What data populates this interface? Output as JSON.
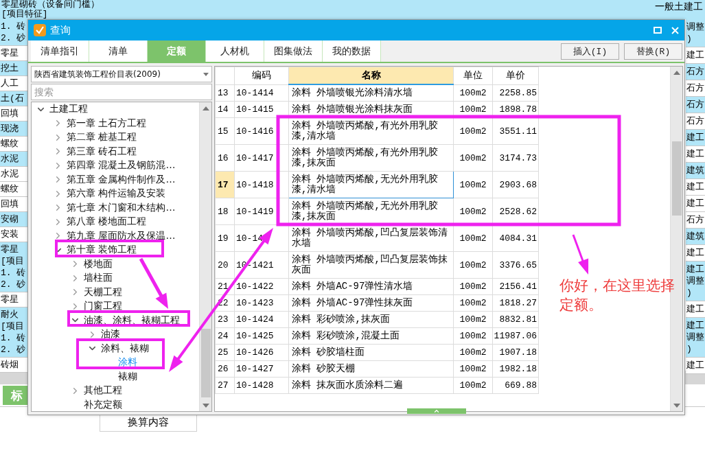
{
  "background": {
    "top_lines": [
      "零星砌砖（设备间门槛）",
      "[项目特征]"
    ],
    "top_right": "一般土建工",
    "left_cells": [
      {
        "lines": [
          "1. 砖",
          "2. 砂"
        ],
        "highlighted": true
      },
      {
        "lines": [
          "零星"
        ],
        "highlighted": false
      },
      {
        "lines": [
          "挖土"
        ],
        "highlighted": true
      },
      {
        "lines": [
          "人工"
        ],
        "highlighted": false
      },
      {
        "lines": [
          "土(石"
        ],
        "highlighted": true
      },
      {
        "lines": [
          "回填"
        ],
        "highlighted": false
      },
      {
        "lines": [
          "现浇"
        ],
        "highlighted": true
      },
      {
        "lines": [
          "螺纹"
        ],
        "highlighted": false
      },
      {
        "lines": [
          "水泥"
        ],
        "highlighted": true
      },
      {
        "lines": [
          "水泥"
        ],
        "highlighted": false
      },
      {
        "lines": [
          "螺纹"
        ],
        "highlighted": false
      },
      {
        "lines": [
          "回填"
        ],
        "highlighted": false
      },
      {
        "lines": [
          "安砌"
        ],
        "highlighted": true
      },
      {
        "lines": [
          "安装"
        ],
        "highlighted": false
      },
      {
        "lines": [
          "零星",
          "[项目",
          "1. 砖",
          "2. 砂"
        ],
        "highlighted": true
      },
      {
        "lines": [
          "零星"
        ],
        "highlighted": false
      },
      {
        "lines": [
          "耐火",
          "[项目",
          "1. 砖",
          "2. 砂"
        ],
        "highlighted": true
      },
      {
        "lines": [
          "砖烟"
        ],
        "highlighted": false
      }
    ],
    "right_cells": [
      {
        "lines": [
          "调整",
          ")"
        ],
        "highlighted": true
      },
      {
        "lines": [
          "建工"
        ],
        "highlighted": false
      },
      {
        "lines": [
          "石方"
        ],
        "highlighted": true
      },
      {
        "lines": [
          "石方"
        ],
        "highlighted": false
      },
      {
        "lines": [
          "石方"
        ],
        "highlighted": true
      },
      {
        "lines": [
          "石方"
        ],
        "highlighted": false
      },
      {
        "lines": [
          "建工"
        ],
        "highlighted": true
      },
      {
        "lines": [
          "建工"
        ],
        "highlighted": false
      },
      {
        "lines": [
          "建筑"
        ],
        "highlighted": true
      },
      {
        "lines": [
          "建工"
        ],
        "highlighted": false
      },
      {
        "lines": [
          "建工"
        ],
        "highlighted": false
      },
      {
        "lines": [
          "石方"
        ],
        "highlighted": false
      },
      {
        "lines": [
          "建筑"
        ],
        "highlighted": true
      },
      {
        "lines": [
          "建工"
        ],
        "highlighted": false
      },
      {
        "lines": [
          "建工",
          "调整",
          ")"
        ],
        "highlighted": true
      },
      {
        "lines": [
          "建工"
        ],
        "highlighted": false
      },
      {
        "lines": [
          "建工",
          "调整",
          ")"
        ],
        "highlighted": true
      },
      {
        "lines": [
          "建工"
        ],
        "highlighted": false
      }
    ],
    "bottom_tab": {
      "label": "标",
      "selected": true
    },
    "bottom_cell": "换算内容"
  },
  "dialog": {
    "title": "查询",
    "tabs": [
      {
        "label": "清单指引",
        "selected": false
      },
      {
        "label": "清单",
        "selected": false
      },
      {
        "label": "定额",
        "selected": true
      },
      {
        "label": "人材机",
        "selected": false
      },
      {
        "label": "图集做法",
        "selected": false
      },
      {
        "label": "我的数据",
        "selected": false
      }
    ],
    "buttons": [
      "插入(I)",
      "替换(R)"
    ],
    "library": "陕西省建筑装饰工程价目表(2009)",
    "search": {
      "placeholder": "搜索"
    },
    "tree": [
      {
        "label": "土建工程",
        "expanded": true,
        "selected": false,
        "children": [
          {
            "label": "第一章  土石方工程",
            "expanded": false,
            "selected": false
          },
          {
            "label": "第二章  桩基工程",
            "expanded": false,
            "selected": false
          },
          {
            "label": "第三章  砖石工程",
            "expanded": false,
            "selected": false
          },
          {
            "label": "第四章  混凝土及钢筋混…",
            "expanded": false,
            "selected": false
          },
          {
            "label": "第五章  金属构件制作及…",
            "expanded": false,
            "selected": false
          },
          {
            "label": "第六章  构件运输及安装",
            "expanded": false,
            "selected": false
          },
          {
            "label": "第七章  木门窗和木结构…",
            "expanded": false,
            "selected": false
          },
          {
            "label": "第八章  楼地面工程",
            "expanded": false,
            "selected": false
          },
          {
            "label": "第九章  屋面防水及保温…",
            "expanded": false,
            "selected": false
          },
          {
            "label": "第十章  装饰工程",
            "expanded": true,
            "selected": false,
            "children": [
              {
                "label": "楼地面",
                "expanded": false,
                "selected": false
              },
              {
                "label": "墙柱面",
                "expanded": false,
                "selected": false
              },
              {
                "label": "天棚工程",
                "expanded": false,
                "selected": false
              },
              {
                "label": "门窗工程",
                "expanded": false,
                "selected": false
              },
              {
                "label": "油漆、涂料、裱糊工程",
                "expanded": true,
                "selected": false,
                "children": [
                  {
                    "label": "油漆",
                    "expanded": false,
                    "selected": false
                  },
                  {
                    "label": "涂料、裱糊",
                    "expanded": true,
                    "selected": false,
                    "children": [
                      {
                        "label": "涂料",
                        "selected": true
                      },
                      {
                        "label": "裱糊",
                        "selected": false
                      }
                    ]
                  }
                ]
              },
              {
                "label": "其他工程",
                "expanded": false,
                "selected": false
              },
              {
                "label": "补充定额",
                "selected": false
              }
            ]
          }
        ]
      }
    ],
    "table": {
      "columns": [
        {
          "label": "编码",
          "selected": false
        },
        {
          "label": "名称",
          "selected": true
        },
        {
          "label": "单位",
          "selected": false
        },
        {
          "label": "单价",
          "selected": false
        }
      ],
      "rows": [
        {
          "num": "13",
          "code": "10-1414",
          "name": "涂料  外墙喷银光涂料清水墙",
          "unit": "100m2",
          "price": "2258.85",
          "selected": false
        },
        {
          "num": "14",
          "code": "10-1415",
          "name": "涂料  外墙喷银光涂料抹灰面",
          "unit": "100m2",
          "price": "1898.78",
          "selected": false
        },
        {
          "num": "15",
          "code": "10-1416",
          "name": "涂料  外墙喷丙烯酸,有光外用乳胶漆,清水墙",
          "unit": "100m2",
          "price": "3551.11",
          "selected": false
        },
        {
          "num": "16",
          "code": "10-1417",
          "name": "涂料  外墙喷丙烯酸,有光外用乳胶漆,抹灰面",
          "unit": "100m2",
          "price": "3174.73",
          "selected": false
        },
        {
          "num": "17",
          "code": "10-1418",
          "name": "涂料  外墙喷丙烯酸,无光外用乳胶漆,清水墙",
          "unit": "100m2",
          "price": "2903.68",
          "selected": true
        },
        {
          "num": "18",
          "code": "10-1419",
          "name": "涂料  外墙喷丙烯酸,无光外用乳胶漆,抹灰面",
          "unit": "100m2",
          "price": "2528.62",
          "selected": false
        },
        {
          "num": "19",
          "code": "10-14",
          "name": "涂料  外墙喷丙烯酸,凹凸复层装饰清水墙",
          "unit": "100m2",
          "price": "4084.31",
          "selected": false
        },
        {
          "num": "20",
          "code": "10-1421",
          "name": "涂料  外墙喷丙烯酸,凹凸复层装饰抹灰面",
          "unit": "100m2",
          "price": "3376.65",
          "selected": false
        },
        {
          "num": "21",
          "code": "10-1422",
          "name": "涂料  外墙AC-97弹性清水墙",
          "unit": "100m2",
          "price": "2156.41",
          "selected": false
        },
        {
          "num": "22",
          "code": "10-1423",
          "name": "涂料  外墙AC-97弹性抹灰面",
          "unit": "100m2",
          "price": "1818.27",
          "selected": false
        },
        {
          "num": "23",
          "code": "10-1424",
          "name": "涂料  彩砂喷涂,抹灰面",
          "unit": "100m2",
          "price": "8832.81",
          "selected": false
        },
        {
          "num": "24",
          "code": "10-1425",
          "name": "涂料  彩砂喷涂,混凝土面",
          "unit": "100m2",
          "price": "11987.06",
          "selected": false
        },
        {
          "num": "25",
          "code": "10-1426",
          "name": "涂料  砂胶墙柱面",
          "unit": "100m2",
          "price": "1907.18",
          "selected": false
        },
        {
          "num": "26",
          "code": "10-1427",
          "name": "涂料  砂胶天棚",
          "unit": "100m2",
          "price": "1982.18",
          "selected": false
        },
        {
          "num": "27",
          "code": "10-1428",
          "name": "涂料  抹灰面水质涂料二遍",
          "unit": "100m2",
          "price": "669.88",
          "selected": false
        }
      ]
    }
  },
  "note": "你好，在这里选择定额。"
}
